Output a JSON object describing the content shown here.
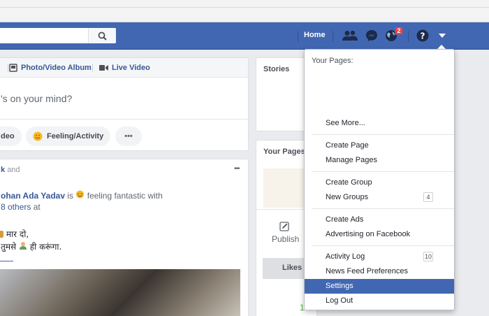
{
  "nav": {
    "home_label": "Home",
    "notification_count": "2"
  },
  "composer": {
    "tab_photo_album": "Photo/Video Album",
    "tab_live_video": "Live Video",
    "placeholder": "'s on your mind?",
    "video_pill": "deo",
    "feeling_pill": "Feeling/Activity",
    "more_pill": "•••"
  },
  "stories": {
    "title": "Stories"
  },
  "your_pages": {
    "title": "Your Pages",
    "publish_label": "Publish",
    "likes_label": "Likes",
    "partial_value": "1"
  },
  "post": {
    "header_fragment": "k",
    "header_and": "and",
    "author": "ohan Ada Yadav",
    "is_word": "is",
    "feeling_text": "feeling fantastic with",
    "others_link": "8 others",
    "at_word": "at",
    "line1": "मार दो,",
    "line2_start": "तुमसे",
    "line2_end": "ही करूंगा.",
    "more_dots": "•••"
  },
  "dropdown": {
    "header": "Your Pages:",
    "see_more": "See More...",
    "create_page": "Create Page",
    "manage_pages": "Manage Pages",
    "create_group": "Create Group",
    "new_groups": "New Groups",
    "new_groups_count": "4",
    "create_ads": "Create Ads",
    "advertising": "Advertising on Facebook",
    "activity_log": "Activity Log",
    "activity_log_count": "10",
    "news_feed_prefs": "News Feed Preferences",
    "settings": "Settings",
    "log_out": "Log Out"
  },
  "colors": {
    "brand": "#4267b2",
    "link": "#365899",
    "badge": "#fa3e3e"
  }
}
